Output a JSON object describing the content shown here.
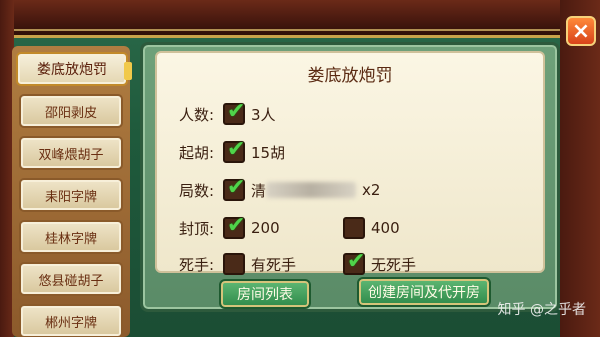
{
  "sidebar": {
    "items": [
      {
        "label": "娄底放炮罚",
        "active": true
      },
      {
        "label": "邵阳剥皮"
      },
      {
        "label": "双峰煨胡子"
      },
      {
        "label": "耒阳字牌"
      },
      {
        "label": "桂林字牌"
      },
      {
        "label": "悠县碰胡子"
      },
      {
        "label": "郴州字牌"
      }
    ]
  },
  "panel": {
    "title": "娄底放炮罚",
    "rows": {
      "players": {
        "label": "人数:",
        "option": "3人"
      },
      "qihu": {
        "label": "起胡:",
        "option": "15胡"
      },
      "rounds": {
        "label": "局数:",
        "option_prefix": "清",
        "option_suffix": "x2"
      },
      "cap": {
        "label": "封顶:",
        "option1": "200",
        "option2": "400"
      },
      "sishou": {
        "label": "死手:",
        "option1": "有死手",
        "option2": "无死手"
      }
    }
  },
  "buttons": {
    "room_list": "房间列表",
    "create_room": "创建房间及代开房",
    "close": "×"
  },
  "watermark": "知乎 @之乎者",
  "colors": {
    "accent_green": "#4fd44a",
    "panel_bg": "#fbf6e4",
    "title_text": "#5a2a12"
  }
}
